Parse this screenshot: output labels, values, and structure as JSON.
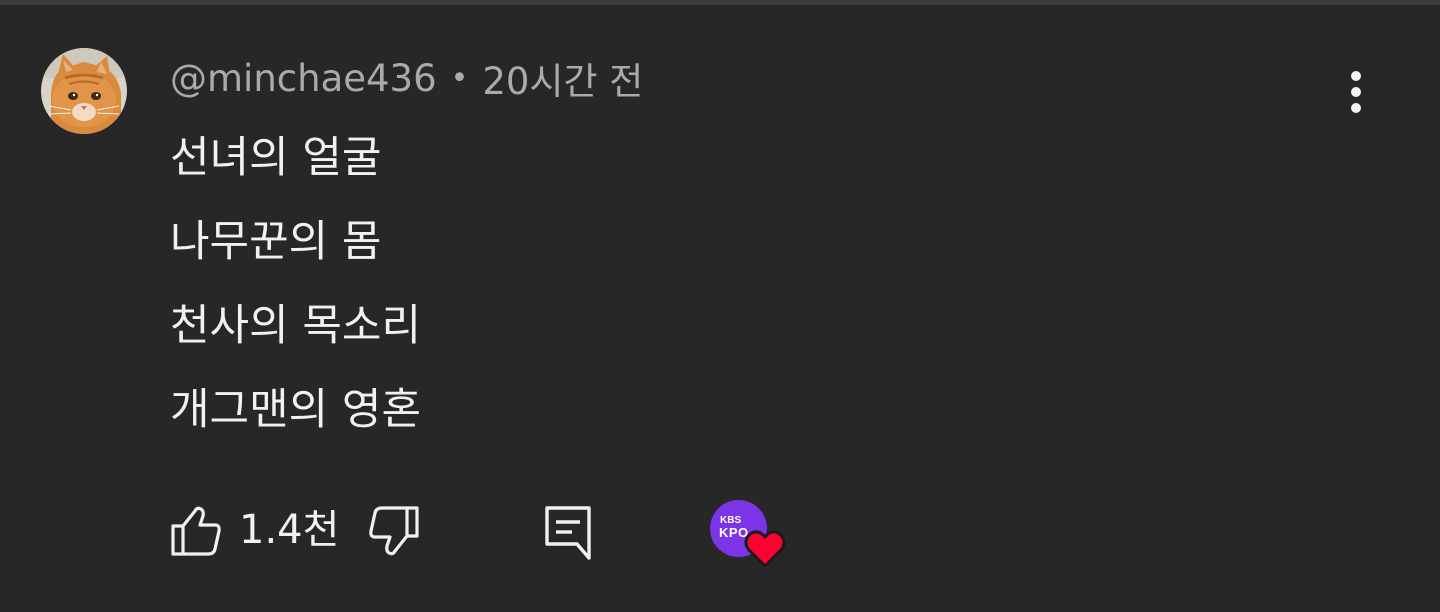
{
  "comment": {
    "author": "@minchae436",
    "separator": "•",
    "timestamp": "20시간 전",
    "avatar_icon": "orange-cat-avatar",
    "lines": [
      "선녀의 얼굴",
      "나무꾼의 몸",
      "천사의 목소리",
      "개그맨의 영혼"
    ]
  },
  "actions": {
    "like_count": "1.4천",
    "like_icon": "thumbs-up-icon",
    "dislike_icon": "thumbs-down-icon",
    "reply_icon": "reply-comment-icon",
    "more_icon": "more-vertical-icon"
  },
  "creator_heart": {
    "channel_logo_line1": "KBS",
    "channel_logo_line2": "KPO",
    "logo_color": "#7b35e6",
    "heart_color": "#ff0033"
  },
  "colors": {
    "background": "#272727",
    "primary_text": "#f1f1f1",
    "secondary_text": "#aaaaaa"
  }
}
